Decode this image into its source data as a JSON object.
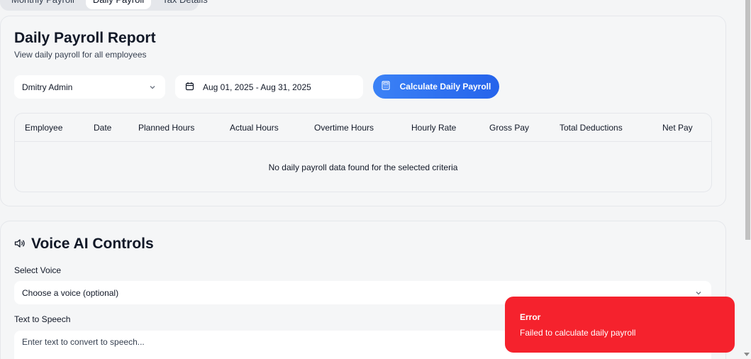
{
  "tabs": [
    {
      "label": "Monthly Payroll"
    },
    {
      "label": "Daily Payroll"
    },
    {
      "label": "Tax Details"
    }
  ],
  "payroll": {
    "title": "Daily Payroll Report",
    "subtitle": "View daily payroll for all employees",
    "employee_select": "Dmitry Admin",
    "date_range": "Aug 01, 2025 - Aug 31, 2025",
    "calculate_button": "Calculate Daily Payroll",
    "accent": "#2563eb",
    "table": {
      "columns": [
        "Employee",
        "Date",
        "Planned Hours",
        "Actual Hours",
        "Overtime Hours",
        "Hourly Rate",
        "Gross Pay",
        "Total Deductions",
        "Net Pay"
      ],
      "empty_message": "No daily payroll data found for the selected criteria"
    }
  },
  "voice": {
    "title": "Voice AI Controls",
    "select_label": "Select Voice",
    "select_value": "Choose a voice (optional)",
    "tts_label": "Text to Speech",
    "tts_placeholder": "Enter text to convert to speech..."
  },
  "toast": {
    "title": "Error",
    "message": "Failed to calculate daily payroll",
    "color": "#f5222d"
  }
}
